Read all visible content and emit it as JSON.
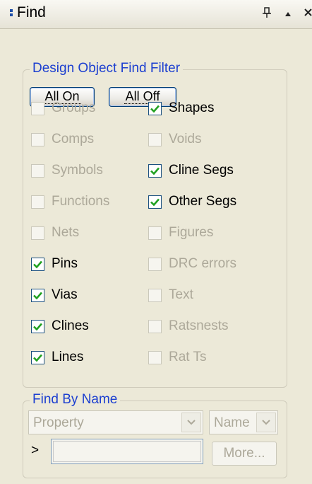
{
  "panel": {
    "title": "Find"
  },
  "filter": {
    "legend": "Design Object Find Filter",
    "all_on": "All On",
    "all_off": "All Off",
    "left": [
      {
        "label": "Groups",
        "checked": false,
        "enabled": false
      },
      {
        "label": "Comps",
        "checked": false,
        "enabled": false
      },
      {
        "label": "Symbols",
        "checked": false,
        "enabled": false
      },
      {
        "label": "Functions",
        "checked": false,
        "enabled": false
      },
      {
        "label": "Nets",
        "checked": false,
        "enabled": false
      },
      {
        "label": "Pins",
        "checked": true,
        "enabled": true
      },
      {
        "label": "Vias",
        "checked": true,
        "enabled": true
      },
      {
        "label": "Clines",
        "checked": true,
        "enabled": true
      },
      {
        "label": "Lines",
        "checked": true,
        "enabled": true
      }
    ],
    "right": [
      {
        "label": "Shapes",
        "checked": true,
        "enabled": true
      },
      {
        "label": "Voids",
        "checked": false,
        "enabled": false
      },
      {
        "label": "Cline Segs",
        "checked": true,
        "enabled": true
      },
      {
        "label": "Other Segs",
        "checked": true,
        "enabled": true
      },
      {
        "label": "Figures",
        "checked": false,
        "enabled": false
      },
      {
        "label": "DRC errors",
        "checked": false,
        "enabled": false
      },
      {
        "label": "Text",
        "checked": false,
        "enabled": false
      },
      {
        "label": "Ratsnests",
        "checked": false,
        "enabled": false
      },
      {
        "label": "Rat Ts",
        "checked": false,
        "enabled": false
      }
    ]
  },
  "find_by_name": {
    "legend": "Find By Name",
    "type_select": "Property",
    "mode_select": "Name",
    "prompt": ">",
    "value": "",
    "more": "More..."
  }
}
